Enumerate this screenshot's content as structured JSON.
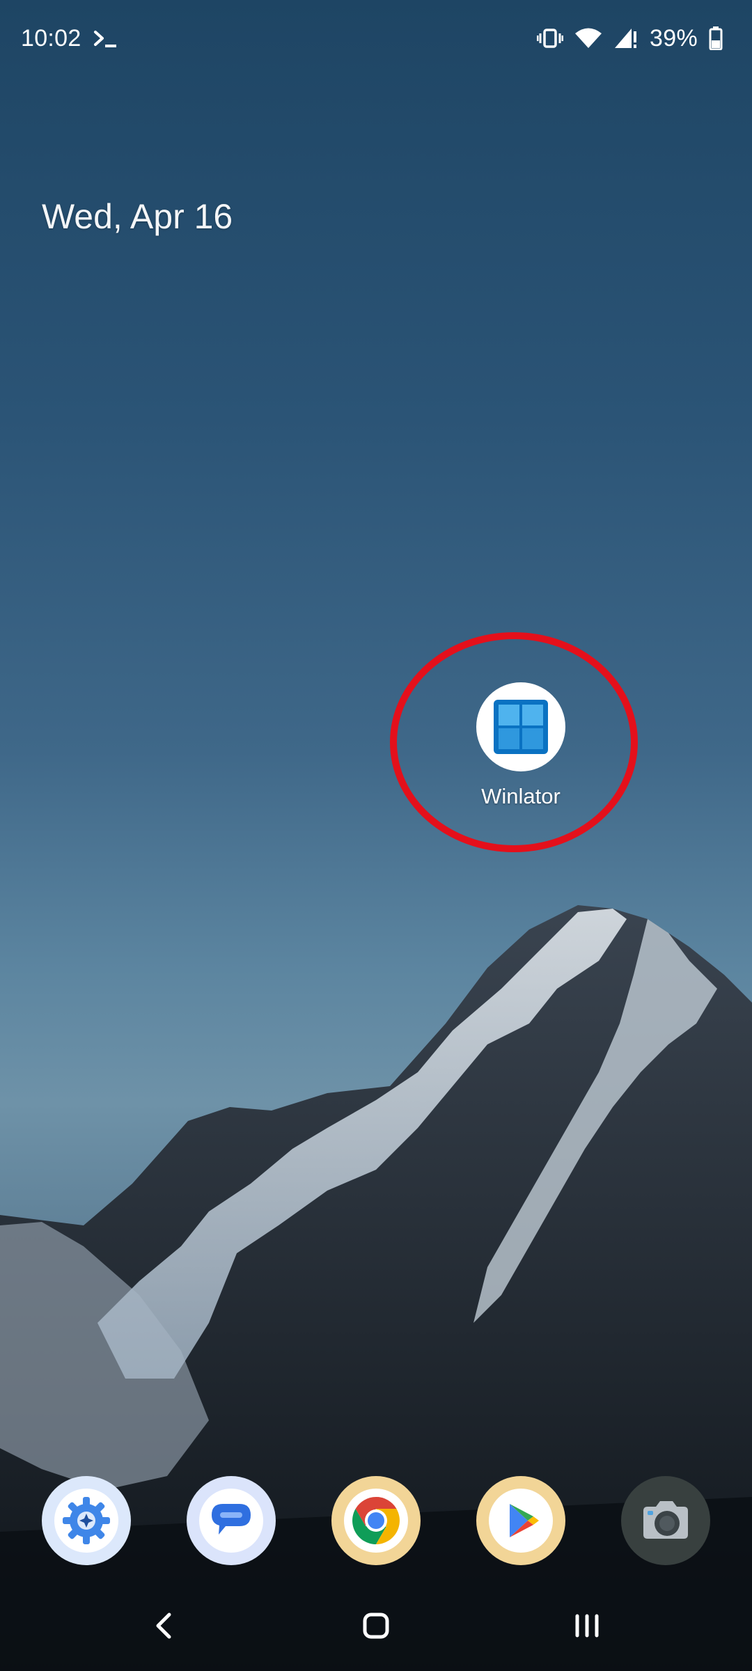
{
  "status_bar": {
    "time": "10:02",
    "battery": "39%",
    "icons": [
      "terminal-icon",
      "vibrate-icon",
      "wifi-icon",
      "cellular-signal-icon",
      "battery-icon"
    ]
  },
  "home": {
    "date": "Wed, Apr 16",
    "apps": [
      {
        "label": "Winlator",
        "icon": "winlator-windows-icon"
      }
    ]
  },
  "dock": {
    "apps": [
      {
        "icon": "settings-gear-icon"
      },
      {
        "icon": "messages-icon"
      },
      {
        "icon": "chrome-icon"
      },
      {
        "icon": "play-store-icon"
      },
      {
        "icon": "camera-icon"
      }
    ]
  },
  "navigation": {
    "buttons": [
      "back-icon",
      "home-icon",
      "recents-icon"
    ]
  },
  "colors": {
    "highlight": "#e4101b",
    "winlator_blue": "#0a72c2"
  }
}
